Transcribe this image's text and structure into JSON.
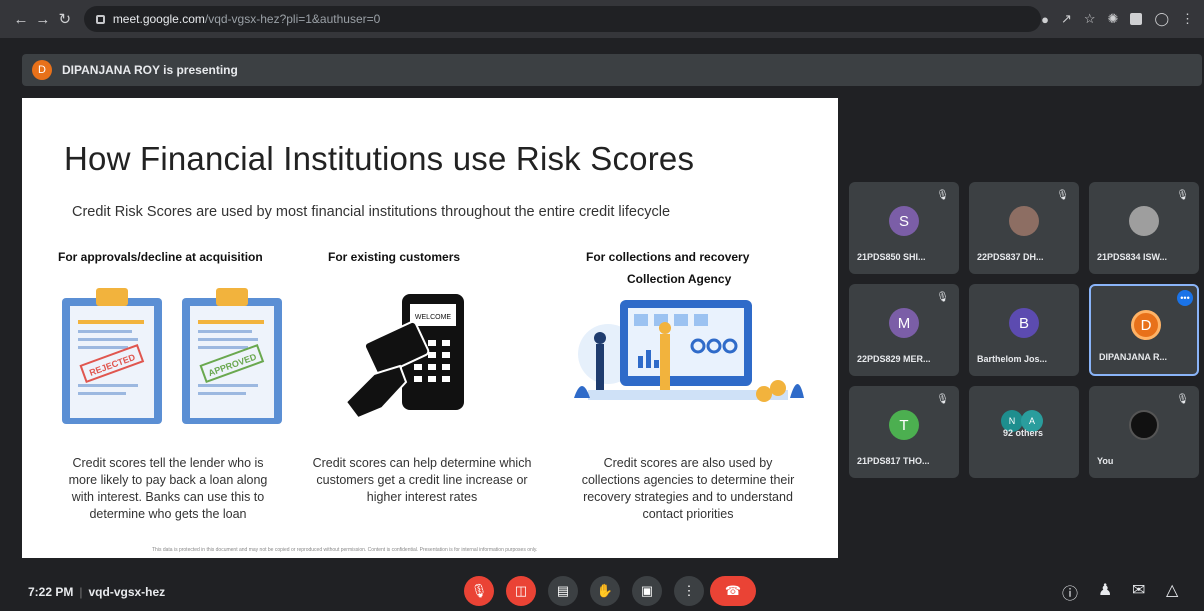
{
  "browser": {
    "url_domain": "meet.google.com",
    "url_path": "/vqd-vgsx-hez?pli=1&authuser=0"
  },
  "presenting": {
    "avatar_letter": "D",
    "text": "DIPANJANA ROY is presenting"
  },
  "slide": {
    "title": "How Financial Institutions use Risk Scores",
    "subtitle": "Credit Risk Scores are used by most financial institutions throughout the entire credit lifecycle",
    "columns": [
      {
        "heading": "For approvals/decline at acquisition",
        "text": "Credit scores tell the lender who is more likely to pay back a loan along with interest. Banks can use this to determine who gets the loan",
        "stamps": [
          "REJECTED",
          "APPROVED"
        ]
      },
      {
        "heading": "For existing customers",
        "text": "Credit scores can help determine which customers get a credit line increase or higher interest rates",
        "terminal_label": "WELCOME"
      },
      {
        "heading": "For collections and recovery",
        "subheading": "Collection Agency",
        "text": "Credit scores are also used by collections agencies to determine their recovery strategies and to understand contact priorities"
      }
    ],
    "footer": "This data is protected in this document and may not be copied or reproduced without permission. Content is confidential. Presentation is for internal information purposes only."
  },
  "participants": [
    {
      "name": "21PDS850 SHI...",
      "letter": "S",
      "color": "#7b5ea7"
    },
    {
      "name": "22PDS837 DH...",
      "letter": "",
      "color": "#8d6e63"
    },
    {
      "name": "21PDS834 ISW...",
      "letter": "",
      "color": "#9e9e9e"
    },
    {
      "name": "22PDS829 MER...",
      "letter": "M",
      "color": "#7b5ea7"
    },
    {
      "name": "Barthelom Jos...",
      "letter": "B",
      "color": "#5c4bb0"
    },
    {
      "name": "DIPANJANA R...",
      "letter": "D",
      "color": "#e8711a"
    },
    {
      "name": "21PDS817 THO...",
      "letter": "T",
      "color": "#4caf50"
    },
    {
      "name": "92 others",
      "letter": "",
      "color": "#1e8e8e"
    },
    {
      "name": "You",
      "letter": "",
      "color": "#111111"
    }
  ],
  "bottom": {
    "time": "7:22 PM",
    "meeting_code": "vqd-vgsx-hez"
  },
  "colors": {
    "red": "#ea4335",
    "dark": "#202124",
    "tile": "#3c4043",
    "accent": "#8ab4f8"
  }
}
